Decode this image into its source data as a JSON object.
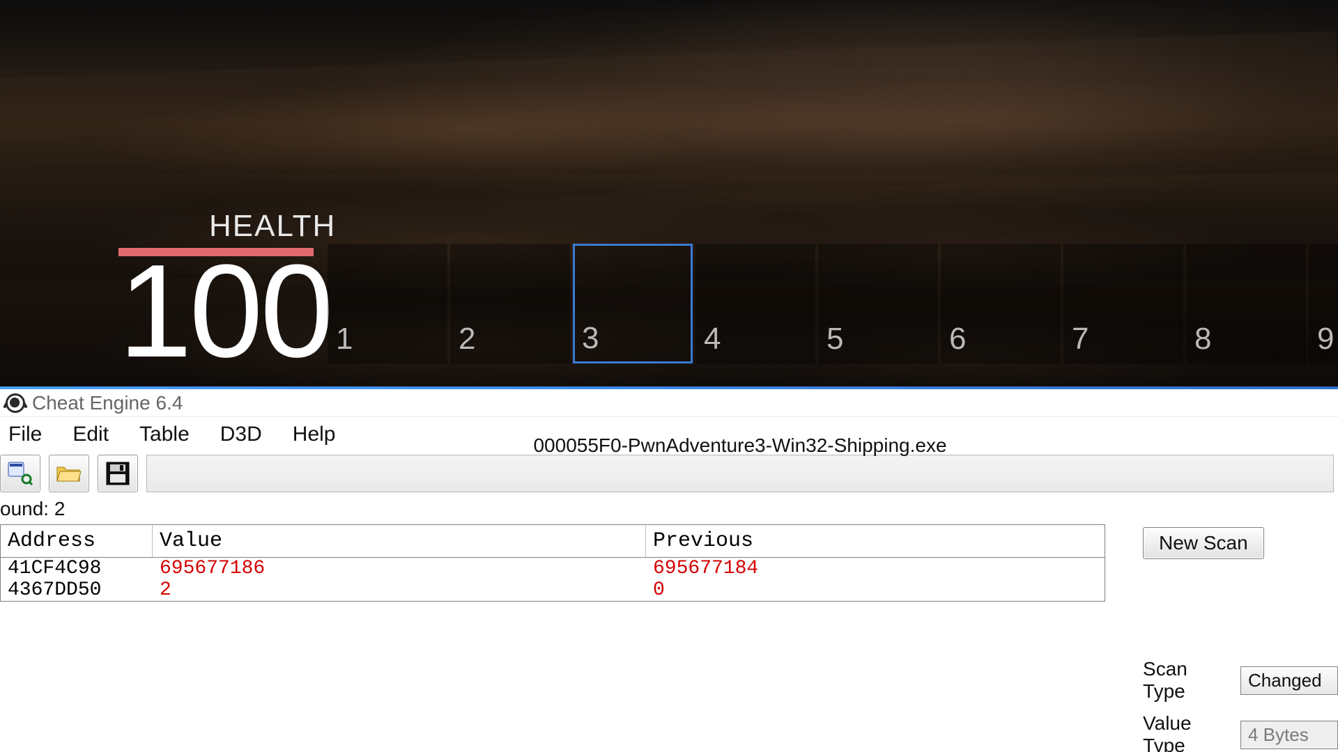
{
  "game": {
    "health_label": "HEALTH",
    "health_value": "100",
    "hotbar": {
      "selected_index": 2,
      "slots": [
        "1",
        "2",
        "3",
        "4",
        "5",
        "6",
        "7",
        "8",
        "9"
      ]
    }
  },
  "cheatengine": {
    "title": "Cheat Engine 6.4",
    "menu": {
      "file": "File",
      "edit": "Edit",
      "table": "Table",
      "d3d": "D3D",
      "help": "Help"
    },
    "process_name": "000055F0-PwnAdventure3-Win32-Shipping.exe",
    "found_label": "ound: 2",
    "columns": {
      "address": "Address",
      "value": "Value",
      "previous": "Previous"
    },
    "rows": [
      {
        "address": "41CF4C98",
        "value": "695677186",
        "previous": "695677184"
      },
      {
        "address": "4367DD50",
        "value": "2",
        "previous": "0"
      }
    ],
    "buttons": {
      "new_scan": "New Scan"
    },
    "scan_type_label": "Scan Type",
    "scan_type_value": "Changed",
    "value_type_label": "Value Type",
    "value_type_value": "4 Bytes",
    "icons": {
      "process": "process-icon",
      "open": "open-folder-icon",
      "save": "floppy-disk-icon"
    }
  }
}
